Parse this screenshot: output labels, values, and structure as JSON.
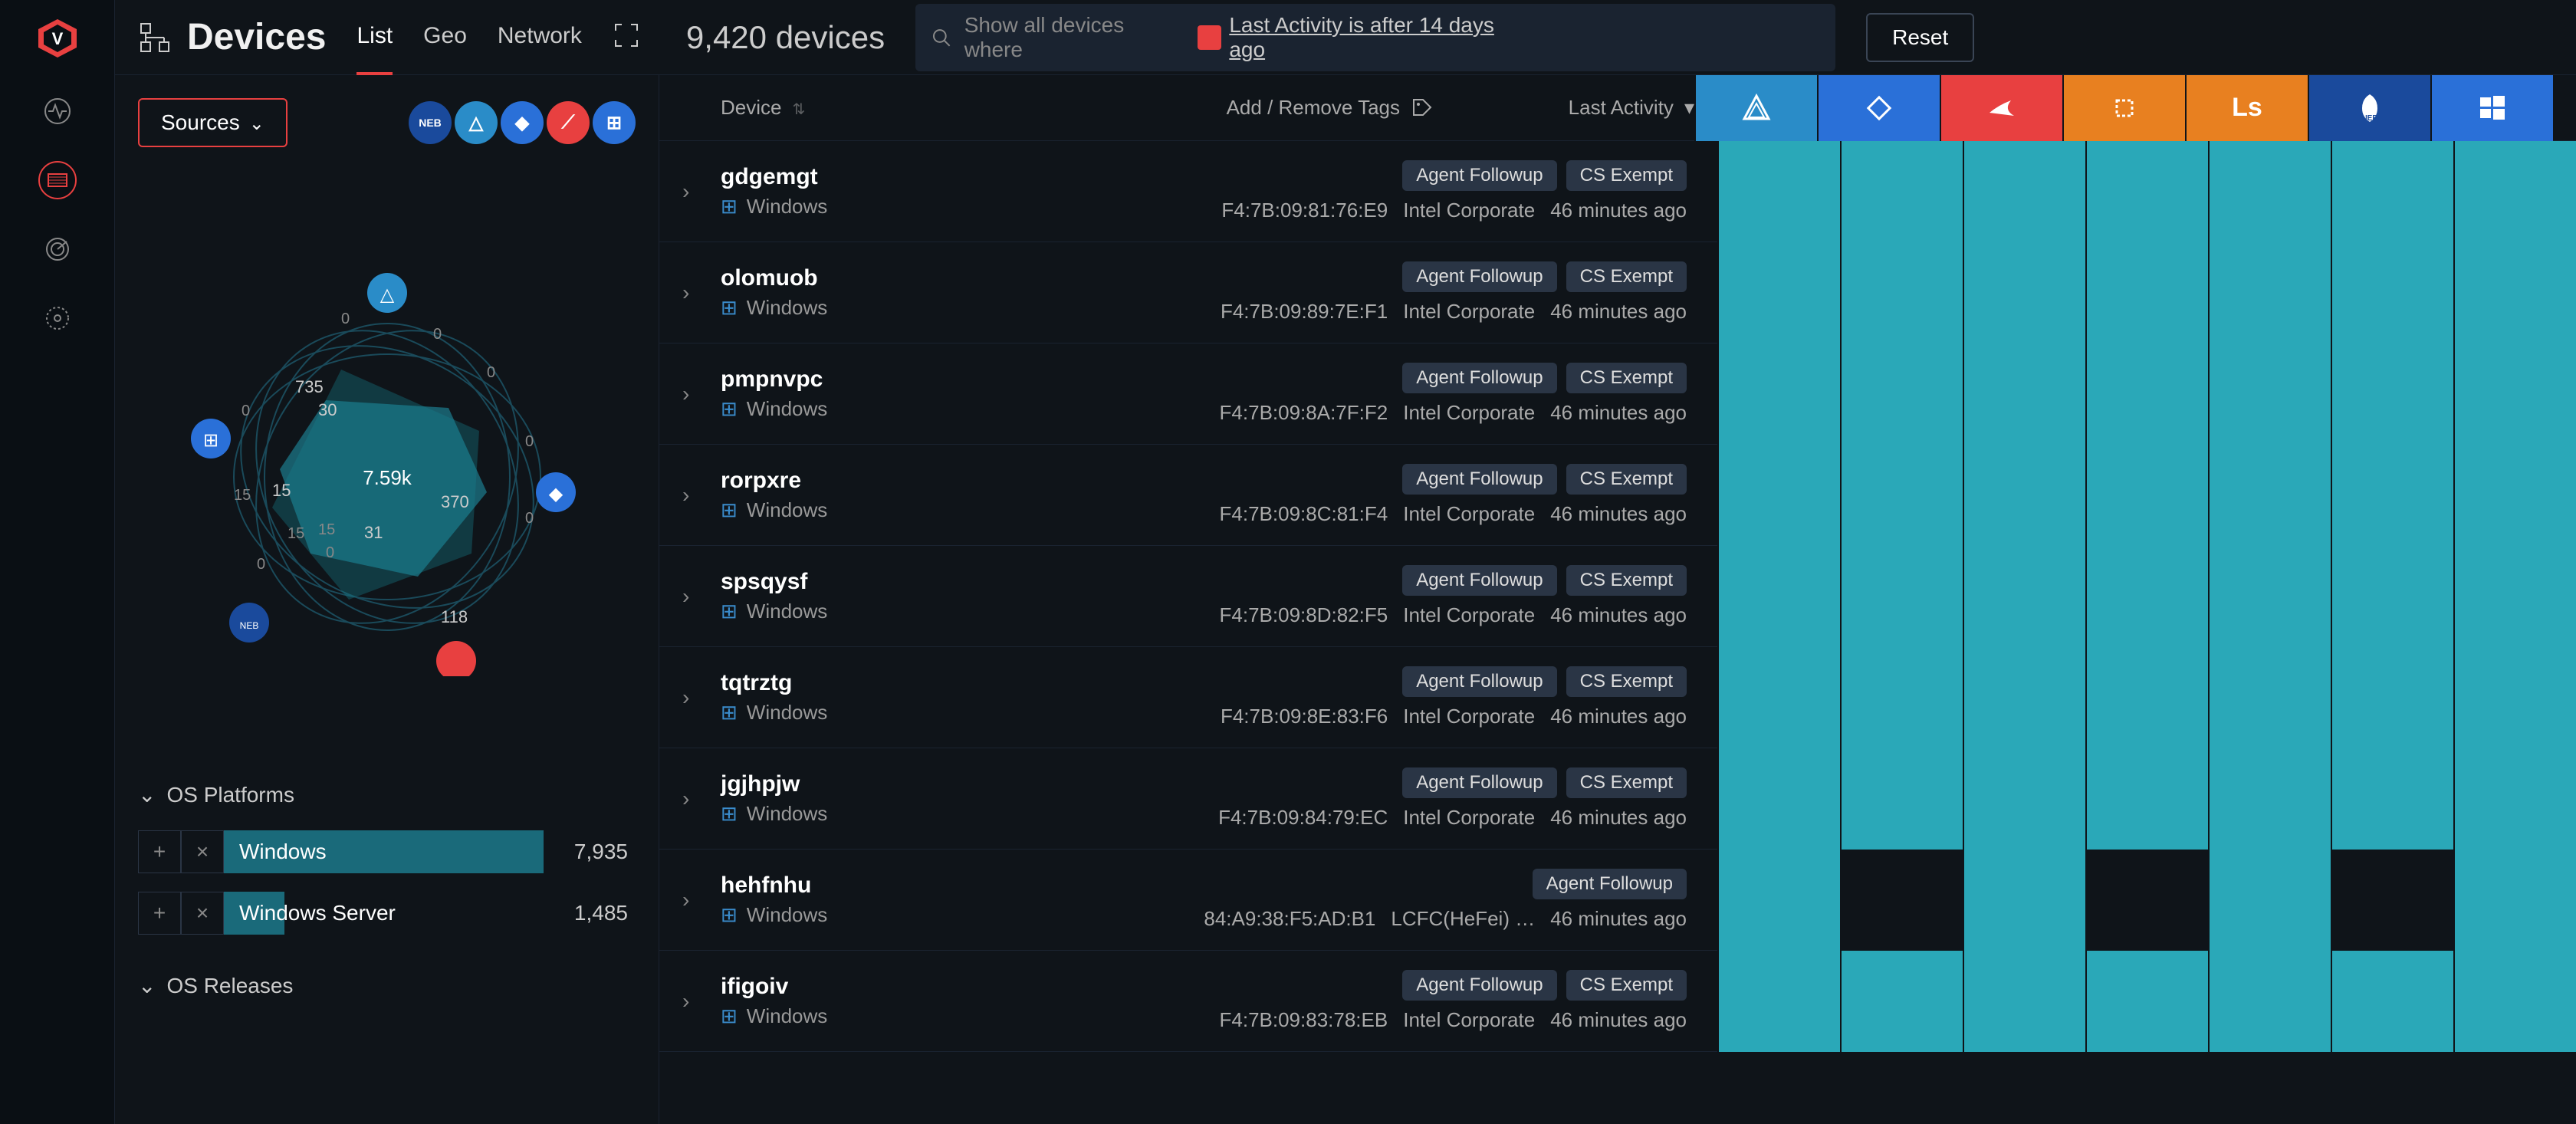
{
  "header": {
    "title": "Devices",
    "tabs": [
      "List",
      "Geo",
      "Network"
    ],
    "active_tab": 0,
    "device_count": "9,420 devices",
    "search_placeholder": "Show all devices where",
    "filter_text": "Last Activity is after 14 days ago",
    "reset_label": "Reset"
  },
  "sources_btn": "Sources",
  "chart_data": {
    "type": "radar",
    "center_value": "7.59k",
    "points": [
      {
        "label": "735"
      },
      {
        "label": "30"
      },
      {
        "label": "370"
      },
      {
        "label": "31"
      },
      {
        "label": "118"
      },
      {
        "label": "15"
      }
    ],
    "outer_labels": [
      "0",
      "0",
      "0",
      "0",
      "0",
      "0",
      "0",
      "0",
      "0",
      "15",
      "15",
      "0",
      "0",
      "0",
      "15"
    ]
  },
  "source_badges": [
    {
      "name": "neb",
      "label": "NEB",
      "color": "#1a4a9c"
    },
    {
      "name": "triangle",
      "label": "△",
      "color": "#2a8cc8"
    },
    {
      "name": "diamond",
      "label": "◆",
      "color": "#2a70d8"
    },
    {
      "name": "crowdstrike",
      "label": "⟋",
      "color": "#e84040"
    },
    {
      "name": "windows",
      "label": "⊞",
      "color": "#2a70d8"
    }
  ],
  "facets": {
    "os_platforms": {
      "title": "OS Platforms",
      "items": [
        {
          "label": "Windows",
          "count": "7,935",
          "pct": 100
        },
        {
          "label": "Windows Server",
          "count": "1,485",
          "pct": 19
        }
      ]
    },
    "os_releases": {
      "title": "OS Releases"
    }
  },
  "table": {
    "headers": {
      "device": "Device",
      "tags": "Add / Remove Tags",
      "activity": "Last Activity"
    },
    "source_columns": [
      "triangle",
      "diamond",
      "crowdstrike",
      "expand",
      "ls",
      "neb",
      "windows"
    ],
    "rows": [
      {
        "name": "gdgemgt",
        "os": "Windows",
        "mac": "F4:7B:09:81:76:E9",
        "vendor": "Intel Corporate",
        "activity": "46 minutes ago",
        "tags": [
          "Agent Followup",
          "CS Exempt"
        ],
        "cells": [
          1,
          1,
          1,
          1,
          1,
          1,
          1
        ]
      },
      {
        "name": "olomuob",
        "os": "Windows",
        "mac": "F4:7B:09:89:7E:F1",
        "vendor": "Intel Corporate",
        "activity": "46 minutes ago",
        "tags": [
          "Agent Followup",
          "CS Exempt"
        ],
        "cells": [
          1,
          1,
          1,
          1,
          1,
          1,
          1
        ]
      },
      {
        "name": "pmpnvpc",
        "os": "Windows",
        "mac": "F4:7B:09:8A:7F:F2",
        "vendor": "Intel Corporate",
        "activity": "46 minutes ago",
        "tags": [
          "Agent Followup",
          "CS Exempt"
        ],
        "cells": [
          1,
          1,
          1,
          1,
          1,
          1,
          1
        ]
      },
      {
        "name": "rorpxre",
        "os": "Windows",
        "mac": "F4:7B:09:8C:81:F4",
        "vendor": "Intel Corporate",
        "activity": "46 minutes ago",
        "tags": [
          "Agent Followup",
          "CS Exempt"
        ],
        "cells": [
          1,
          1,
          1,
          1,
          1,
          1,
          1
        ]
      },
      {
        "name": "spsqysf",
        "os": "Windows",
        "mac": "F4:7B:09:8D:82:F5",
        "vendor": "Intel Corporate",
        "activity": "46 minutes ago",
        "tags": [
          "Agent Followup",
          "CS Exempt"
        ],
        "cells": [
          1,
          1,
          1,
          1,
          1,
          1,
          1
        ]
      },
      {
        "name": "tqtrztg",
        "os": "Windows",
        "mac": "F4:7B:09:8E:83:F6",
        "vendor": "Intel Corporate",
        "activity": "46 minutes ago",
        "tags": [
          "Agent Followup",
          "CS Exempt"
        ],
        "cells": [
          1,
          1,
          1,
          1,
          1,
          1,
          1
        ]
      },
      {
        "name": "jgjhpjw",
        "os": "Windows",
        "mac": "F4:7B:09:84:79:EC",
        "vendor": "Intel Corporate",
        "activity": "46 minutes ago",
        "tags": [
          "Agent Followup",
          "CS Exempt"
        ],
        "cells": [
          1,
          1,
          1,
          1,
          1,
          1,
          1
        ]
      },
      {
        "name": "hehfnhu",
        "os": "Windows",
        "mac": "84:A9:38:F5:AD:B1",
        "vendor": "LCFC(HeFei) …",
        "activity": "46 minutes ago",
        "tags": [
          "Agent Followup"
        ],
        "cells": [
          1,
          0,
          1,
          0,
          1,
          0,
          1
        ]
      },
      {
        "name": "ifigoiv",
        "os": "Windows",
        "mac": "F4:7B:09:83:78:EB",
        "vendor": "Intel Corporate",
        "activity": "46 minutes ago",
        "tags": [
          "Agent Followup",
          "CS Exempt"
        ],
        "cells": [
          1,
          1,
          1,
          1,
          1,
          1,
          1
        ]
      }
    ]
  }
}
